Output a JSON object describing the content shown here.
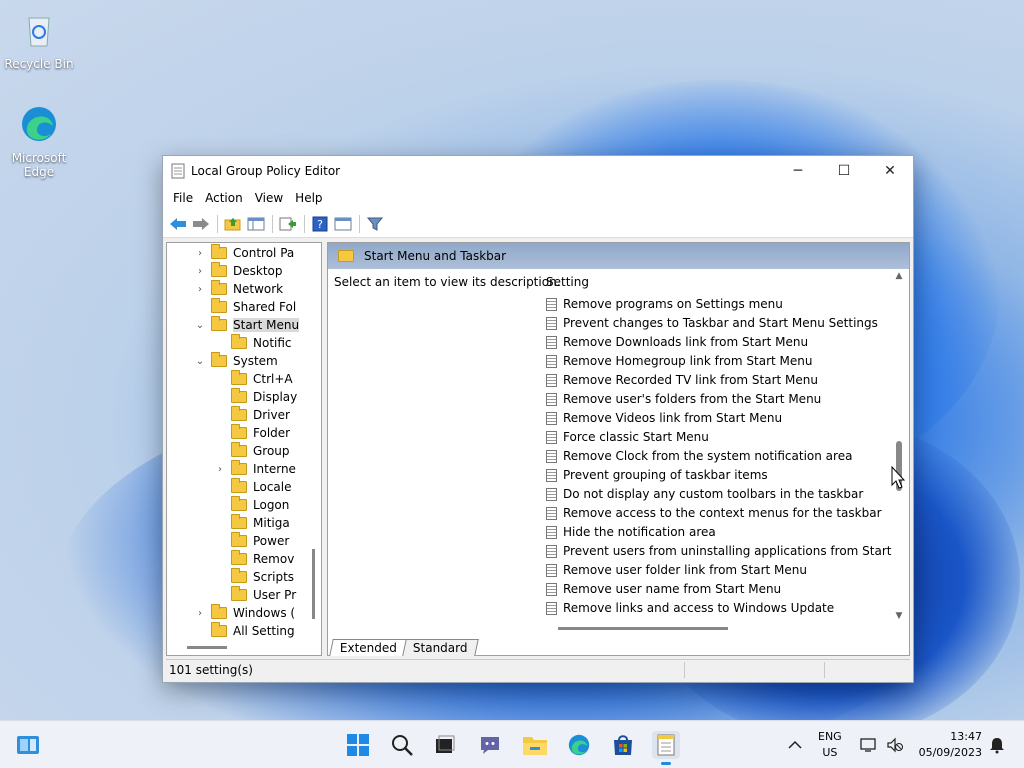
{
  "desktop": {
    "icons": [
      {
        "label": "Recycle Bin"
      },
      {
        "label": "Microsoft Edge"
      }
    ]
  },
  "window": {
    "title": "Local Group Policy Editor",
    "controls": {
      "minimize": "─",
      "maximize": "☐",
      "close": "✕"
    },
    "menu": [
      "File",
      "Action",
      "View",
      "Help"
    ],
    "tree": [
      {
        "label": "Control Pa",
        "chevron": "›",
        "indent": 1
      },
      {
        "label": "Desktop",
        "chevron": "›",
        "indent": 1
      },
      {
        "label": "Network",
        "chevron": "›",
        "indent": 1
      },
      {
        "label": "Shared Fol",
        "chevron": "",
        "indent": 1
      },
      {
        "label": "Start Menu",
        "chevron": "⌄",
        "indent": 1,
        "selected": true
      },
      {
        "label": "Notific",
        "chevron": "",
        "indent": 2
      },
      {
        "label": "System",
        "chevron": "⌄",
        "indent": 1
      },
      {
        "label": "Ctrl+A",
        "chevron": "",
        "indent": 2
      },
      {
        "label": "Display",
        "chevron": "",
        "indent": 2
      },
      {
        "label": "Driver",
        "chevron": "",
        "indent": 2
      },
      {
        "label": "Folder",
        "chevron": "",
        "indent": 2
      },
      {
        "label": "Group",
        "chevron": "",
        "indent": 2
      },
      {
        "label": "Interne",
        "chevron": "›",
        "indent": 2
      },
      {
        "label": "Locale",
        "chevron": "",
        "indent": 2
      },
      {
        "label": "Logon",
        "chevron": "",
        "indent": 2
      },
      {
        "label": "Mitiga",
        "chevron": "",
        "indent": 2
      },
      {
        "label": "Power",
        "chevron": "",
        "indent": 2
      },
      {
        "label": "Remov",
        "chevron": "",
        "indent": 2
      },
      {
        "label": "Scripts",
        "chevron": "",
        "indent": 2
      },
      {
        "label": "User Pr",
        "chevron": "",
        "indent": 2
      },
      {
        "label": "Windows (",
        "chevron": "›",
        "indent": 1
      },
      {
        "label": "All Setting",
        "chevron": "",
        "indent": 1
      }
    ],
    "panel": {
      "header": "Start Menu and Taskbar",
      "description": "Select an item to view its description.",
      "column_header": "Setting",
      "settings": [
        "Remove programs on Settings menu",
        "Prevent changes to Taskbar and Start Menu Settings",
        "Remove Downloads link from Start Menu",
        "Remove Homegroup link from Start Menu",
        "Remove Recorded TV link from Start Menu",
        "Remove user's folders from the Start Menu",
        "Remove Videos link from Start Menu",
        "Force classic Start Menu",
        "Remove Clock from the system notification area",
        "Prevent grouping of taskbar items",
        "Do not display any custom toolbars in the taskbar",
        "Remove access to the context menus for the taskbar",
        "Hide the notification area",
        "Prevent users from uninstalling applications from Start",
        "Remove user folder link from Start Menu",
        "Remove user name from Start Menu",
        "Remove links and access to Windows Update"
      ],
      "tabs": [
        "Extended",
        "Standard"
      ]
    },
    "status": "101 setting(s)"
  },
  "taskbar": {
    "lang_top": "ENG",
    "lang_bottom": "US",
    "time": "13:47",
    "date": "05/09/2023"
  }
}
